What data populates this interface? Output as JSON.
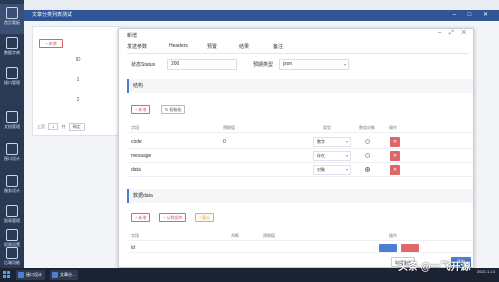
{
  "sidebar": {
    "items": [
      {
        "label": "首页看板",
        "icon": "dashboard-icon"
      },
      {
        "label": "数据字典",
        "icon": "book-icon"
      },
      {
        "label": "接口管理",
        "icon": "api-icon"
      },
      {
        "label": "文档管理",
        "icon": "document-icon"
      },
      {
        "label": "接口设计",
        "icon": "design-icon"
      },
      {
        "label": "服务设计",
        "icon": "service-icon"
      },
      {
        "label": "报表管理",
        "icon": "report-icon"
      },
      {
        "label": "权限设置",
        "icon": "lock-icon"
      },
      {
        "label": "后端功能",
        "icon": "settings-icon"
      }
    ]
  },
  "background_window": {
    "title": "文章分类列表测试",
    "add_label": "+ 新增",
    "column_header": "ID",
    "rows": [
      "1",
      "2"
    ],
    "pager": {
      "prev": "上页",
      "page": "1",
      "of": "共",
      "confirm": "确定"
    }
  },
  "dialog": {
    "title": "新增",
    "tabs": [
      "发送参数",
      "Headers",
      "预置",
      "结果",
      "备注"
    ],
    "status_label": "状态Status",
    "status_value": "200",
    "expect_type_label": "预期类型",
    "expect_type_value": "json",
    "structure_section": {
      "title": "结构",
      "add_label": "+ 新增",
      "init_label": "初始化",
      "headers": [
        "字段",
        "预期值",
        "类型",
        "数组对象",
        "操作"
      ],
      "rows": [
        {
          "field": "code",
          "expected": "0",
          "type": "数字",
          "checked": false
        },
        {
          "field": "message",
          "expected": "",
          "type": "存在",
          "checked": false
        },
        {
          "field": "data",
          "expected": "",
          "type": "对象",
          "checked": true
        }
      ]
    },
    "data_section": {
      "title": "数据data",
      "add_label": "+ 新增",
      "from_db_label": "+ 从数据库",
      "import_label": "↑ 导入",
      "headers": [
        "字段",
        "判断",
        "预期值",
        "操作"
      ],
      "row_field": "id"
    },
    "footer": {
      "cancel_label": "取消操作",
      "confirm_label": "确定"
    }
  },
  "taskbar": {
    "items": [
      "接口设计",
      "文章分..."
    ],
    "tray_time": "",
    "tray_date": "2022-1-13"
  },
  "watermark": "头条 @一飞开源",
  "colors": {
    "accent": "#4a7fd4",
    "danger": "#e06767",
    "sidebar": "#2a3a55",
    "titlebar": "#2f5597"
  }
}
